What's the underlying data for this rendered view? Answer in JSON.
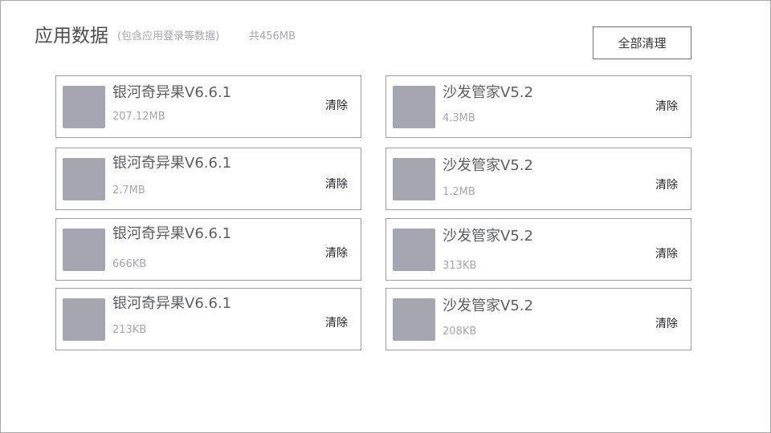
{
  "header": {
    "title": "应用数据",
    "subtitle": "(包含应用登录等数据)",
    "total": "共456MB",
    "clear_all_label": "全部清理"
  },
  "apps": [
    {
      "name": "银河奇异果V6.6.1",
      "size": "207.12MB",
      "clear_label": "清除",
      "icon": "app-placeholder-icon"
    },
    {
      "name": "沙发管家V5.2",
      "size": "4.3MB",
      "clear_label": "清除",
      "icon": "app-placeholder-icon"
    },
    {
      "name": "银河奇异果V6.6.1",
      "size": "2.7MB",
      "clear_label": "清除",
      "icon": "app-placeholder-icon"
    },
    {
      "name": "沙发管家V5.2",
      "size": "1.2MB",
      "clear_label": "清除",
      "icon": "app-placeholder-icon"
    },
    {
      "name": "银河奇异果V6.6.1",
      "size": "666KB",
      "clear_label": "清除",
      "icon": "app-placeholder-icon"
    },
    {
      "name": "沙发管家V5.2",
      "size": "313KB",
      "clear_label": "清除",
      "icon": "app-placeholder-icon"
    },
    {
      "name": "银河奇异果V6.6.1",
      "size": "213KB",
      "clear_label": "清除",
      "icon": "app-placeholder-icon"
    },
    {
      "name": "沙发管家V5.2",
      "size": "208KB",
      "clear_label": "清除",
      "icon": "app-placeholder-icon"
    }
  ],
  "colors": {
    "icon_placeholder": "#a4a7af",
    "card_border": "#9b9da3",
    "title_text": "#4a4c55",
    "muted_text": "#a4a6ad"
  }
}
